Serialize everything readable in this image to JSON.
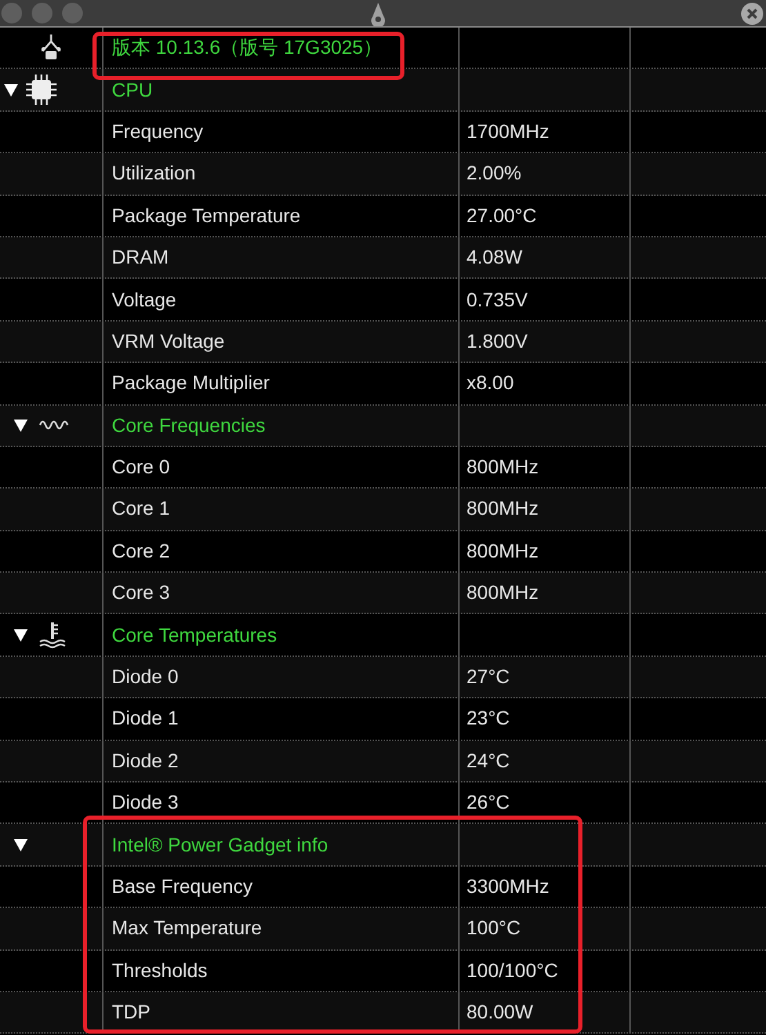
{
  "os_row": {
    "label": "版本 10.13.6（版号 17G3025）",
    "highlighted": true
  },
  "groups": [
    {
      "kind": "cpu",
      "label": "CPU",
      "expanded": true,
      "highlighted": false,
      "items": [
        {
          "label": "Frequency",
          "value": "1700MHz"
        },
        {
          "label": "Utilization",
          "value": "2.00%"
        },
        {
          "label": "Package Temperature",
          "value": "27.00°C"
        },
        {
          "label": "DRAM",
          "value": "4.08W"
        },
        {
          "label": "Voltage",
          "value": "0.735V"
        },
        {
          "label": "VRM Voltage",
          "value": "1.800V"
        },
        {
          "label": "Package Multiplier",
          "value": "x8.00"
        }
      ]
    },
    {
      "kind": "frequency",
      "label": "Core Frequencies",
      "expanded": true,
      "highlighted": false,
      "items": [
        {
          "label": "Core 0",
          "value": "800MHz"
        },
        {
          "label": "Core 1",
          "value": "800MHz"
        },
        {
          "label": "Core 2",
          "value": "800MHz"
        },
        {
          "label": "Core 3",
          "value": "800MHz"
        }
      ]
    },
    {
      "kind": "temperature",
      "label": "Core Temperatures",
      "expanded": true,
      "highlighted": false,
      "items": [
        {
          "label": "Diode 0",
          "value": "27°C"
        },
        {
          "label": "Diode 1",
          "value": "23°C"
        },
        {
          "label": "Diode 2",
          "value": "24°C"
        },
        {
          "label": "Diode 3",
          "value": "26°C"
        }
      ]
    },
    {
      "kind": "info",
      "label": "Intel® Power Gadget info",
      "expanded": true,
      "highlighted": true,
      "items": [
        {
          "label": "Base Frequency",
          "value": "3300MHz"
        },
        {
          "label": "Max Temperature",
          "value": "100°C"
        },
        {
          "label": "Thresholds",
          "value": "100/100°C"
        },
        {
          "label": "TDP",
          "value": "80.00W"
        }
      ]
    }
  ]
}
